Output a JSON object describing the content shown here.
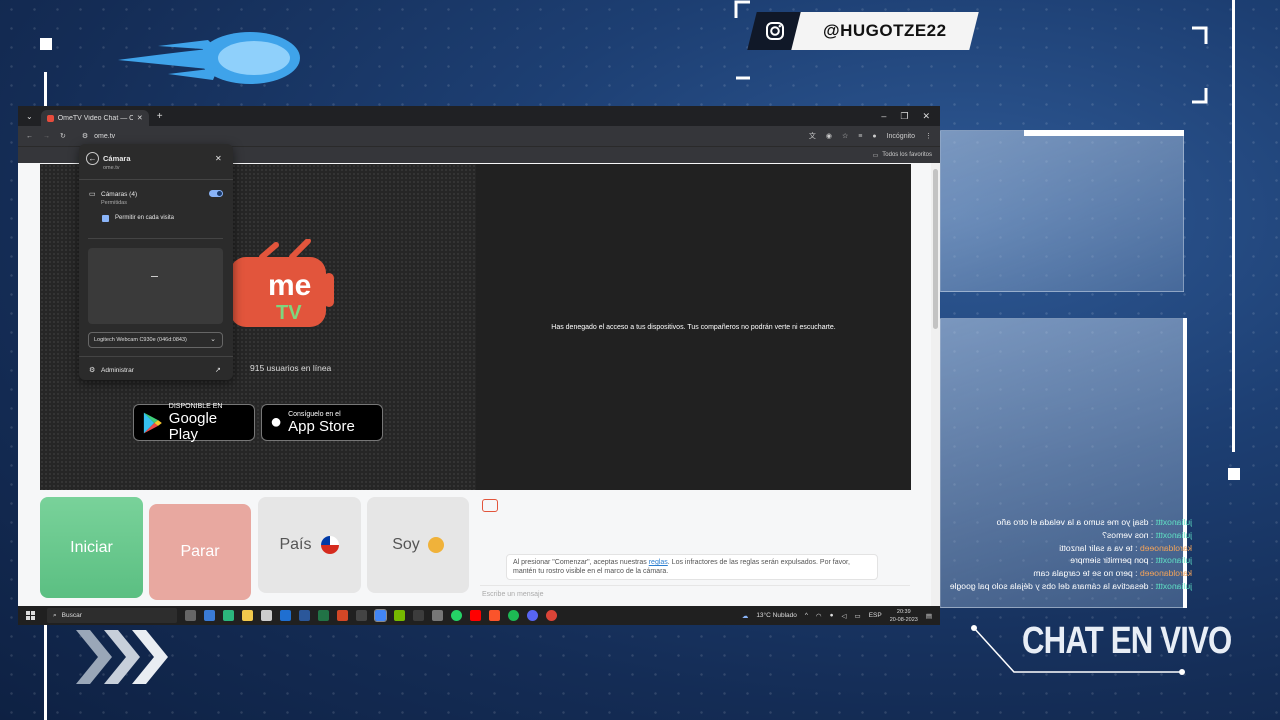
{
  "overlay": {
    "instagram_handle": "@HUGOTZE22",
    "chat_title": "CHAT EN VIVO",
    "chat_messages": [
      {
        "user": "julianoxttt",
        "text": ": dsaj yo me sumo a la velada el otro año"
      },
      {
        "user": "julianoxttt",
        "text": ": nos vemos?"
      },
      {
        "user": "karoldanoeeb",
        "text": ": te va a salir lanzotti"
      },
      {
        "user": "julianoxttt",
        "text": ": pon permitir siempre"
      },
      {
        "user": "karoldanoeeb",
        "text": ": pero no se te cargala cam"
      },
      {
        "user": "julianoxttt",
        "text": ": desactiva la cámara del obs y déjala solo pal google"
      }
    ]
  },
  "browser": {
    "tab_title": "OmeTV Video Chat — Omegle",
    "url": "ome.tv",
    "incognito_label": "Incógnito",
    "favorites_label": "Todos los favoritos"
  },
  "camera_popup": {
    "title": "Cámara",
    "site": "ome.tv",
    "cameras_label": "Cámaras (4)",
    "cameras_status": "Permitidas",
    "checkbox_label": "Permitir en cada visita",
    "device": "Logitech Webcam C930e (046d:0843)",
    "manage_label": "Administrar"
  },
  "page": {
    "online_text": "915 usuarios en línea",
    "denied_message": "Has denegado el acceso a tus dispositivos. Tus compañeros no podrán verte ni escucharte.",
    "google_play_top": "DISPONIBLE EN",
    "google_play_name": "Google Play",
    "app_store_top": "Consíguelo en el",
    "app_store_name": "App Store",
    "start_button": "Iniciar",
    "stop_button": "Parar",
    "country_button": "País",
    "gender_button": "Soy",
    "rules_text_1": "Al presionar \"Comenzar\", aceptas nuestras",
    "rules_link": "reglas",
    "rules_text_2": ". Los infractores de las reglas serán expulsados. Por favor, mantén tu rostro visible en el marco de la cámara.",
    "message_placeholder": "Escribe un mensaje"
  },
  "taskbar": {
    "search_placeholder": "Buscar",
    "weather": "13°C  Nublado",
    "language": "ESP",
    "time": "20:39",
    "date": "20-08-2023"
  }
}
